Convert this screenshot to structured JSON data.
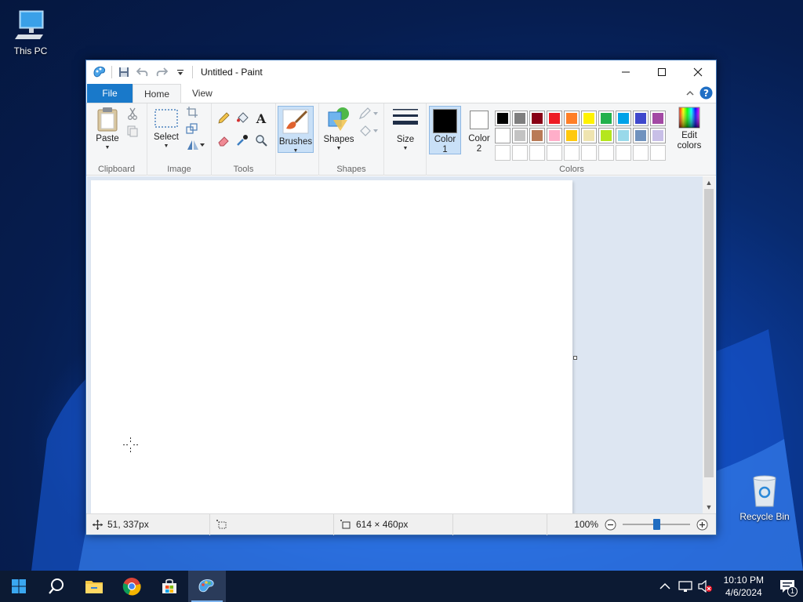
{
  "desktop": {
    "icons": [
      {
        "label": "This PC",
        "icon": "monitor-icon"
      },
      {
        "label": "Recycle Bin",
        "icon": "recycle-bin-icon"
      }
    ]
  },
  "window": {
    "title": "Untitled - Paint",
    "tabs": {
      "file": "File",
      "home": "Home",
      "view": "View"
    }
  },
  "ribbon": {
    "clipboard": {
      "label": "Clipboard",
      "paste": "Paste"
    },
    "image": {
      "label": "Image",
      "select": "Select"
    },
    "tools": {
      "label": "Tools"
    },
    "brushes": {
      "label": "Brushes"
    },
    "shapes": {
      "label": "Shapes",
      "button": "Shapes"
    },
    "size": {
      "label": "Size"
    },
    "colors": {
      "label": "Colors",
      "color1": "Color",
      "color1_num": "1",
      "color2": "Color",
      "color2_num": "2",
      "edit": "Edit",
      "edit2": "colors",
      "color1_value": "#000000",
      "color2_value": "#ffffff",
      "palette_row1": [
        "#000000",
        "#7f7f7f",
        "#880015",
        "#ed1c24",
        "#ff7f27",
        "#fff200",
        "#22b14c",
        "#00a2e8",
        "#3f48cc",
        "#a349a4"
      ],
      "palette_row2": [
        "#ffffff",
        "#c3c3c3",
        "#b97a57",
        "#ffaec9",
        "#ffc90e",
        "#efe4b0",
        "#b5e61d",
        "#99d9ea",
        "#7092be",
        "#c8bfe7"
      ]
    }
  },
  "status": {
    "cursor_pos": "51, 337px",
    "image_size": "614 × 460px",
    "zoom": "100%",
    "zoom_slider_fraction": 0.5
  },
  "taskbar": {
    "time": "10:10 PM",
    "date": "4/6/2024",
    "notification_count": "1"
  }
}
